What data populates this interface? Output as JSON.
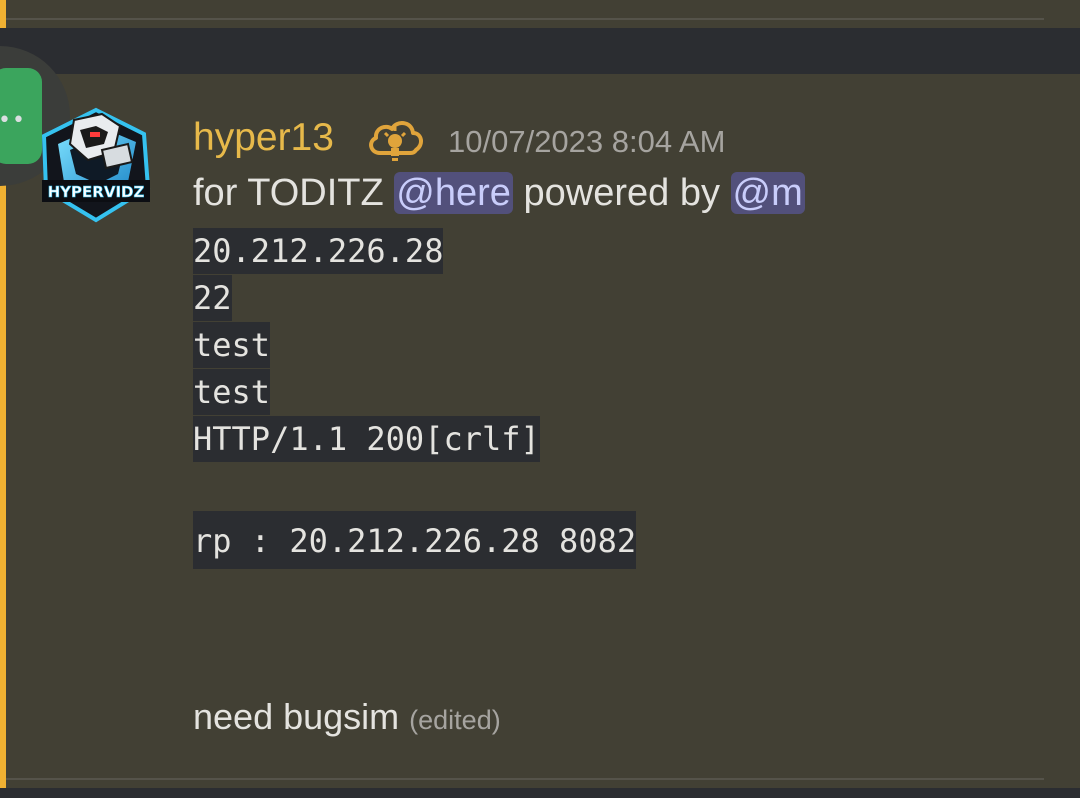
{
  "message": {
    "username": "hyper13",
    "avatar_text": "HYPERVIDZ",
    "role_icon": "cloud-bulb-icon",
    "timestamp": "10/07/2023 8:04 AM",
    "line1_prefix": "for TODITZ",
    "mention_here": "@here",
    "line1_middle": "powered by",
    "mention_m": "@m",
    "code_lines": [
      "20.212.226.28",
      "22",
      "test",
      "test",
      "HTTP/1.1 200[crlf]",
      "rp : 20.212.226.28 8082"
    ],
    "final_text": "need bugsim",
    "edited_label": "(edited)"
  },
  "colors": {
    "accent_bar": "#f0b132",
    "username": "#e7b94a",
    "mention_bg": "#52507b",
    "mention_text": "#c9cdfb",
    "code_bg": "#2b2d31",
    "message_bg": "#424034"
  }
}
